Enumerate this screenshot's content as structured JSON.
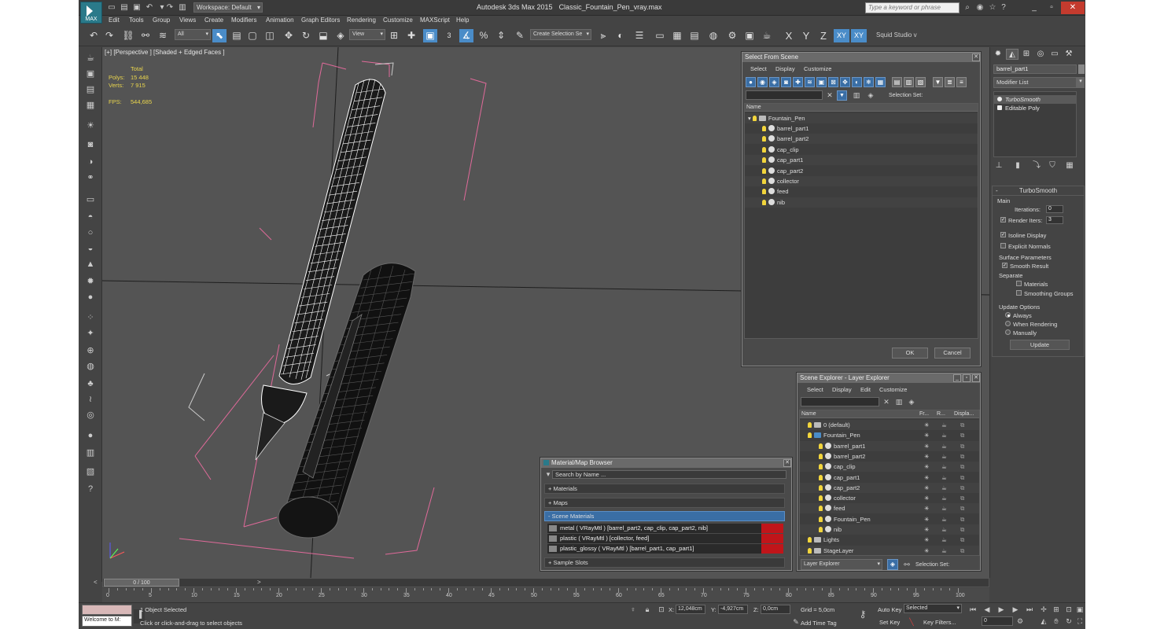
{
  "app": {
    "logo": "MAX",
    "title": "Autodesk 3ds Max  2015",
    "file": "Classic_Fountain_Pen_vray.max",
    "workspace": "Workspace: Default",
    "keyword_placeholder": "Type a keyword or phrase"
  },
  "menus": [
    "Edit",
    "Tools",
    "Group",
    "Views",
    "Create",
    "Modifiers",
    "Animation",
    "Graph Editors",
    "Rendering",
    "Customize",
    "MAXScript",
    "Help"
  ],
  "toolbar": {
    "filter": "All",
    "refcoord": "View",
    "selset": "Create Selection Se",
    "numbers": "3",
    "workspace_right": "Squid Studio v",
    "axes": [
      "X",
      "Y",
      "Z",
      "XY",
      "XY"
    ]
  },
  "viewport": {
    "label": "[+] [Perspective ] [Shaded + Edged Faces ]",
    "stats": {
      "total_label": "Total",
      "polys_label": "Polys:",
      "polys": "15 448",
      "verts_label": "Verts:",
      "verts": "7 915",
      "fps_label": "FPS:",
      "fps": "544,685"
    }
  },
  "select_from_scene": {
    "title": "Select From Scene",
    "menu": [
      "Select",
      "Display",
      "Customize"
    ],
    "selection_set_label": "Selection Set:",
    "col_name": "Name",
    "parent": "Fountain_Pen",
    "children": [
      "barrel_part1",
      "barrel_part2",
      "cap_clip",
      "cap_part1",
      "cap_part2",
      "collector",
      "feed",
      "nib"
    ],
    "ok": "OK",
    "cancel": "Cancel"
  },
  "scene_explorer": {
    "title": "Scene Explorer - Layer Explorer",
    "menu": [
      "Select",
      "Display",
      "Edit",
      "Customize"
    ],
    "cols": [
      "Name",
      "Fr...",
      "R...",
      "Displa..."
    ],
    "rows": [
      {
        "name": "0 (default)",
        "kind": "layer",
        "level": 1
      },
      {
        "name": "Fountain_Pen",
        "kind": "layerblue",
        "level": 1
      },
      {
        "name": "barrel_part1",
        "kind": "ball",
        "level": 2
      },
      {
        "name": "barrel_part2",
        "kind": "ball",
        "level": 2
      },
      {
        "name": "cap_clip",
        "kind": "ball",
        "level": 2
      },
      {
        "name": "cap_part1",
        "kind": "ball",
        "level": 2
      },
      {
        "name": "cap_part2",
        "kind": "ball",
        "level": 2
      },
      {
        "name": "collector",
        "kind": "ball",
        "level": 2
      },
      {
        "name": "feed",
        "kind": "ball",
        "level": 2
      },
      {
        "name": "Fountain_Pen",
        "kind": "ball",
        "level": 2
      },
      {
        "name": "nib",
        "kind": "ball",
        "level": 2
      },
      {
        "name": "Lights",
        "kind": "layer",
        "level": 1
      },
      {
        "name": "StageLayer",
        "kind": "layer",
        "level": 1
      }
    ],
    "bottom_dropdown": "Layer Explorer",
    "selection_set_label": "Selection Set:"
  },
  "material_browser": {
    "title": "Material/Map Browser",
    "search": "Search by Name ...",
    "sections": [
      "+ Materials",
      "+ Maps",
      "- Scene Materials",
      "+ Sample Slots"
    ],
    "materials": [
      "metal  ( VRayMtl ) [barrel_part2, cap_clip, cap_part2, nib]",
      "plastic  ( VRayMtl ) [collector, feed]",
      "plastic_glossy  ( VRayMtl ) [barrel_part1, cap_part1]"
    ]
  },
  "command_panel": {
    "object_name": "barrel_part1",
    "modifier_list": "Modifier List",
    "stack": [
      "TurboSmooth",
      "Editable Poly"
    ],
    "rollout": "TurboSmooth",
    "main": "Main",
    "iterations_label": "Iterations:",
    "iterations": "0",
    "render_iters_label": "Render Iters:",
    "render_iters": "3",
    "isoline": "Isoline Display",
    "explicit": "Explicit Normals",
    "surface": "Surface Parameters",
    "smooth_result": "Smooth Result",
    "separate": "Separate",
    "materials": "Materials",
    "smoothing_groups": "Smoothing Groups",
    "update_options": "Update Options",
    "always": "Always",
    "when_rendering": "When Rendering",
    "manually": "Manually",
    "update": "Update"
  },
  "timeline": {
    "slider": "0 / 100",
    "ticks": [
      "0",
      "5",
      "10",
      "15",
      "20",
      "25",
      "30",
      "35",
      "40",
      "45",
      "50",
      "55",
      "60",
      "65",
      "70",
      "75",
      "80",
      "85",
      "90",
      "95",
      "100"
    ]
  },
  "status": {
    "selected": "1 Object Selected",
    "prompt": "Click or click-and-drag to select objects",
    "maxscript": "Welcome to M:",
    "x_label": "X:",
    "x": "12,048cm",
    "y_label": "Y:",
    "y": "-4,927cm",
    "z_label": "Z:",
    "z": "0,0cm",
    "grid": "Grid = 5,0cm",
    "add_time_tag": "Add Time Tag",
    "auto_key": "Auto Key",
    "set_key": "Set Key",
    "selected_dd": "Selected",
    "key_filters": "Key Filters...",
    "frame": "0"
  }
}
